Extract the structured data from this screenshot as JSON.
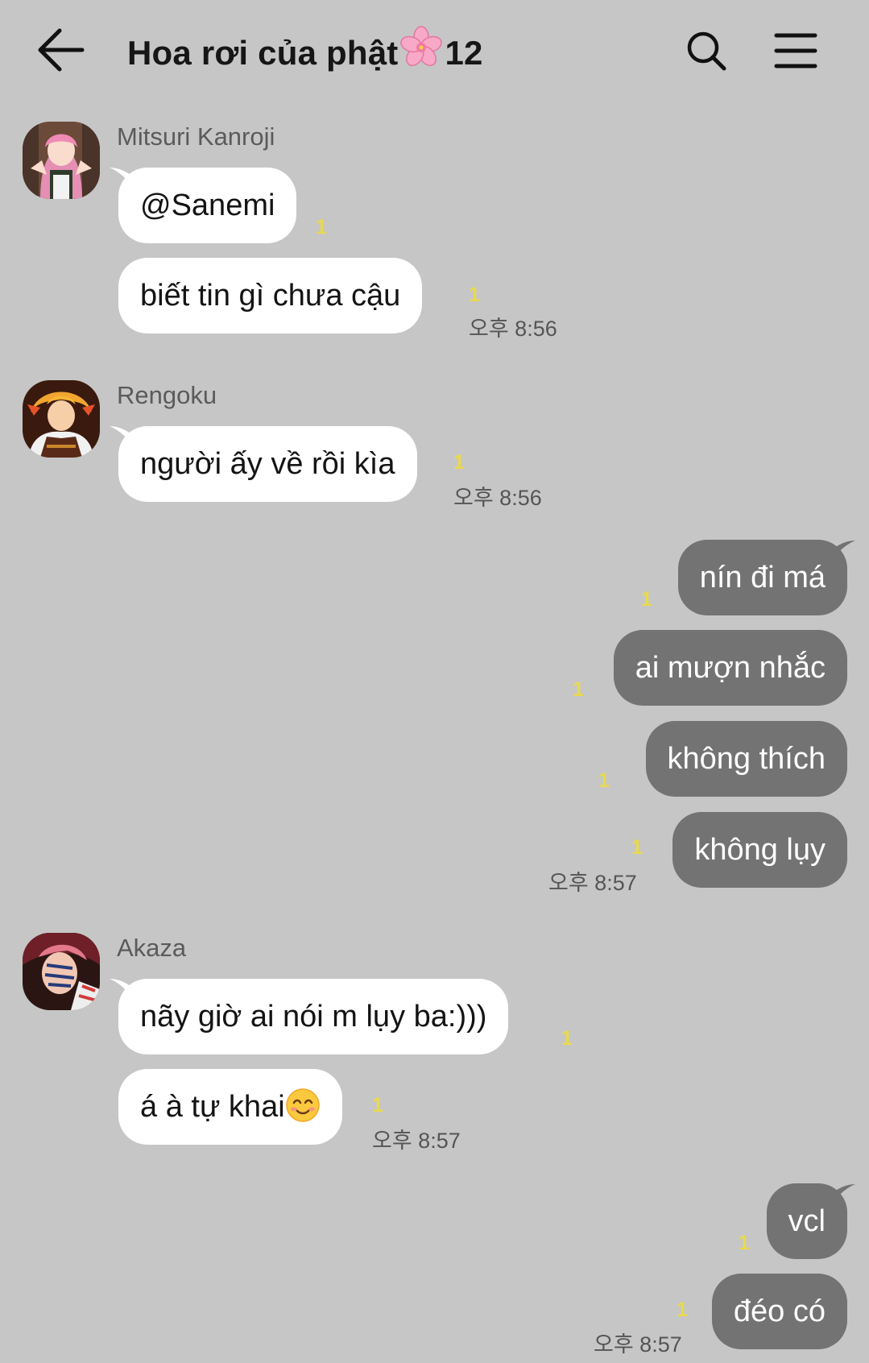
{
  "header": {
    "title": "Hoa rơi của phật",
    "member_count": "12",
    "title_emoji": "cherry-blossom-icon"
  },
  "colors": {
    "background": "#c6c6c6",
    "incoming_bubble": "#ffffff",
    "outgoing_bubble": "#737373",
    "unread": "#e9d94e"
  },
  "messages": {
    "m1": {
      "sender": "Mitsuri Kanroji",
      "texts": [
        "@Sanemi",
        "biết tin gì chưa cậu"
      ],
      "unread": [
        "1",
        "1"
      ],
      "time": "오후 8:56"
    },
    "m2": {
      "sender": "Rengoku",
      "texts": [
        "người ấy về rồi kìa"
      ],
      "unread": [
        "1"
      ],
      "time": "오후 8:56"
    },
    "me1": {
      "texts": [
        "nín đi má",
        "ai mượn nhắc",
        "không thích",
        "không lụy"
      ],
      "unread": [
        "1",
        "1",
        "1",
        "1"
      ],
      "time": "오후 8:57"
    },
    "m3": {
      "sender": "Akaza",
      "texts": [
        "nãy giờ ai nói m lụy ba:)))",
        "á à tự khai"
      ],
      "unread": [
        "1",
        "1"
      ],
      "time": "오후 8:57"
    },
    "me2": {
      "texts": [
        "vcl",
        "đéo có"
      ],
      "unread": [
        "1",
        "1"
      ],
      "time": "오후 8:57"
    }
  }
}
